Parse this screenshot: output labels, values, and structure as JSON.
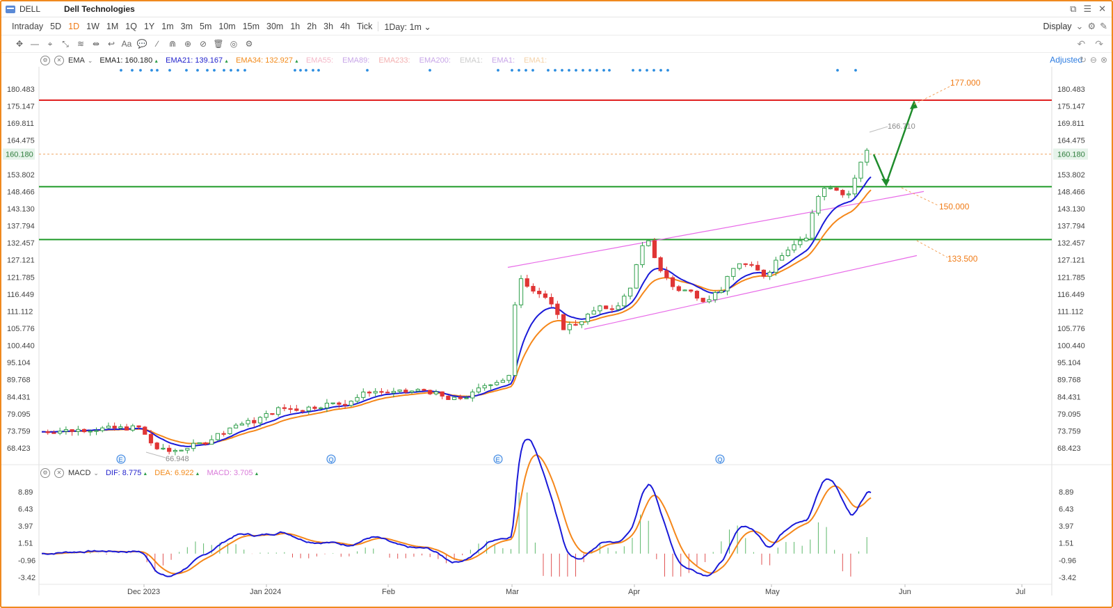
{
  "window": {
    "symbol": "DELL",
    "name": "Dell Technologies",
    "controls": [
      "⧉",
      "☰",
      "✕"
    ]
  },
  "periods": [
    "Intraday",
    "5D",
    "1D",
    "1W",
    "1M",
    "1Q",
    "1Y",
    "1m",
    "3m",
    "5m",
    "10m",
    "15m",
    "30m",
    "1h",
    "2h",
    "3h",
    "4h",
    "Tick"
  ],
  "active_period": "1D",
  "interval_select": "1Day: 1m",
  "display_label": "Display",
  "drawing_tools": [
    "✥",
    "—",
    "⌖",
    "⤡",
    "≋",
    "⇹",
    "↩",
    "Aa",
    "💬",
    "∕",
    "⋒",
    "⊕",
    "⊘",
    "🗑",
    "◎",
    "⚙"
  ],
  "ema_legend": {
    "name": "EMA",
    "items": [
      {
        "label": "EMA1:",
        "value": "160.180",
        "color": "#222222",
        "arrow": "▲"
      },
      {
        "label": "EMA21:",
        "value": "139.167",
        "color": "#2222cc",
        "arrow": "▲"
      },
      {
        "label": "EMA34:",
        "value": "132.927",
        "color": "#f28a1a",
        "arrow": "▲"
      },
      {
        "label": "EMA55:",
        "value": "",
        "color": "#f4b8c8",
        "arrow": ""
      },
      {
        "label": "EMA89:",
        "value": "",
        "color": "#c8a6e8",
        "arrow": ""
      },
      {
        "label": "EMA233:",
        "value": "",
        "color": "#f4b0b0",
        "arrow": ""
      },
      {
        "label": "EMA200:",
        "value": "",
        "color": "#c8a6e8",
        "arrow": ""
      },
      {
        "label": "EMA1:",
        "value": "",
        "color": "#cccccc",
        "arrow": ""
      },
      {
        "label": "EMA1:",
        "value": "",
        "color": "#c8a6e8",
        "arrow": ""
      },
      {
        "label": "EMA1:",
        "value": "",
        "color": "#f4d2a8",
        "arrow": ""
      }
    ]
  },
  "adjusted_label": "Adjusted",
  "macd_legend": {
    "name": "MACD",
    "items": [
      {
        "label": "DIF:",
        "value": "8.775",
        "color": "#2222cc",
        "arrow": "▲"
      },
      {
        "label": "DEA:",
        "value": "6.922",
        "color": "#f28a1a",
        "arrow": "▲"
      },
      {
        "label": "MACD:",
        "value": "3.705",
        "color": "#d97ad9",
        "arrow": "▲"
      }
    ]
  },
  "price_axis": [
    "180.483",
    "175.147",
    "169.811",
    "164.475",
    "160.180",
    "153.802",
    "148.466",
    "143.130",
    "137.794",
    "132.457",
    "127.121",
    "121.785",
    "116.449",
    "111.112",
    "105.776",
    "100.440",
    "95.104",
    "89.768",
    "84.431",
    "79.095",
    "73.759",
    "68.423"
  ],
  "current_price": "160.180",
  "macd_axis": [
    "8.89",
    "6.43",
    "3.97",
    "1.51",
    "-0.96",
    "-3.42"
  ],
  "date_axis": [
    "Dec 2023",
    "Jan 2024",
    "Feb",
    "Mar",
    "Apr",
    "May",
    "Jun",
    "Jul"
  ],
  "annotations": {
    "high_label": "166.710",
    "low_label": "66.948",
    "target_1": "177.000",
    "support_1": "150.000",
    "support_2": "133.500"
  },
  "event_markers": [
    "E",
    "Q",
    "E",
    "Q"
  ],
  "chart_data": {
    "type": "candlestick",
    "resistance_line": 177.0,
    "support_lines": [
      150.0,
      133.5
    ],
    "y_range": [
      66.0,
      183.0
    ],
    "last_close": 160.18,
    "ema21_last": 139.167,
    "ema34_last": 132.927,
    "macd": {
      "dif": 8.775,
      "dea": 6.922,
      "macd": 3.705,
      "y_range": [
        -3.42,
        8.89
      ]
    }
  },
  "colors": {
    "up": "#2e9e4a",
    "down": "#e03535",
    "ema21": "#1a1ad8",
    "ema34": "#f5871a",
    "resistance": "#e02020",
    "support": "#1e9a28",
    "channel": "#e86ae8",
    "accent": "#f07b16"
  }
}
